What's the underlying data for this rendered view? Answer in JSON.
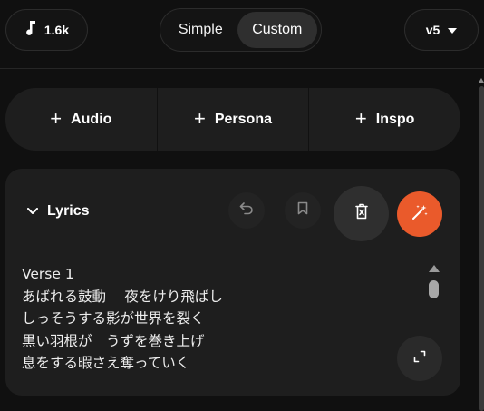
{
  "topbar": {
    "credits": {
      "icon": "music-note-icon",
      "value": "1.6k"
    },
    "mode": {
      "options": [
        "Simple",
        "Custom"
      ],
      "selected": "Custom"
    },
    "version": {
      "label": "v5",
      "icon": "caret-down-icon"
    }
  },
  "add_row": {
    "items": [
      {
        "icon": "plus-icon",
        "label": "Audio"
      },
      {
        "icon": "plus-icon",
        "label": "Persona"
      },
      {
        "icon": "plus-icon",
        "label": "Inspo"
      }
    ]
  },
  "lyrics": {
    "label": "Lyrics",
    "expanded": true,
    "actions": [
      "undo-icon",
      "bookmark-icon",
      "clear-lyrics-icon",
      "magic-wand-icon"
    ],
    "accent_color": "#ea5a2b",
    "lines": [
      "Verse 1",
      "あばれる鼓動　 夜をけり飛ばし",
      "しっそうする影が世界を裂く",
      "黒い羽根が　うずを巻き上げ",
      "息をする暇さえ奪っていく"
    ],
    "expand_icon": "expand-icon"
  }
}
